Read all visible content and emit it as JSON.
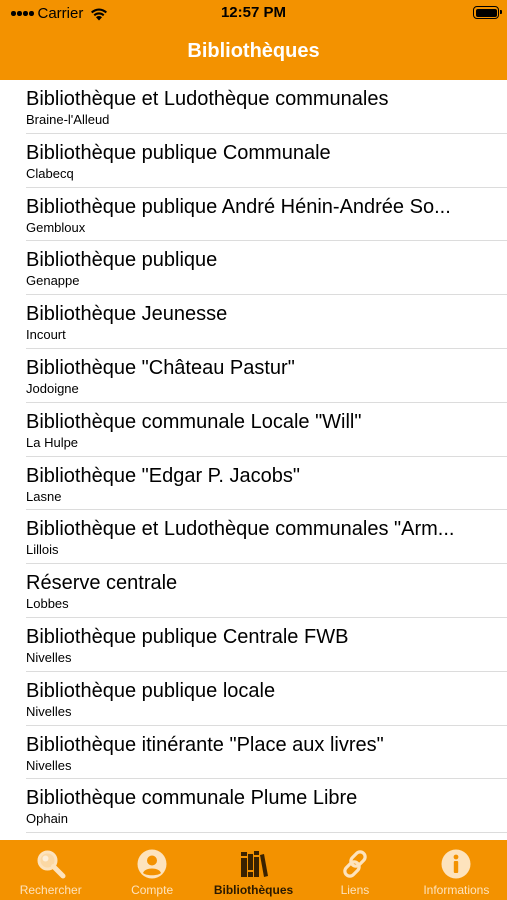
{
  "status_bar": {
    "carrier": "Carrier",
    "time": "12:57 PM"
  },
  "nav": {
    "title": "Bibliothèques"
  },
  "libraries": [
    {
      "name": "Bibliothèque et Ludothèque communales",
      "city": "Braine-l'Alleud"
    },
    {
      "name": "Bibliothèque publique Communale",
      "city": "Clabecq"
    },
    {
      "name": "Bibliothèque publique André Hénin-Andrée So...",
      "city": "Gembloux"
    },
    {
      "name": "Bibliothèque publique",
      "city": "Genappe"
    },
    {
      "name": "Bibliothèque Jeunesse",
      "city": "Incourt"
    },
    {
      "name": "Bibliothèque \"Château Pastur\"",
      "city": "Jodoigne"
    },
    {
      "name": "Bibliothèque communale Locale \"Will\"",
      "city": "La Hulpe"
    },
    {
      "name": "Bibliothèque \"Edgar P. Jacobs\"",
      "city": "Lasne"
    },
    {
      "name": "Bibliothèque et Ludothèque communales \"Arm...",
      "city": "Lillois"
    },
    {
      "name": "Réserve centrale",
      "city": "Lobbes"
    },
    {
      "name": "Bibliothèque publique Centrale FWB",
      "city": "Nivelles"
    },
    {
      "name": "Bibliothèque publique locale",
      "city": "Nivelles"
    },
    {
      "name": "Bibliothèque itinérante \"Place aux livres\"",
      "city": "Nivelles"
    },
    {
      "name": "Bibliothèque communale Plume Libre",
      "city": "Ophain"
    }
  ],
  "tabs": [
    {
      "label": "Rechercher",
      "icon": "search-icon"
    },
    {
      "label": "Compte",
      "icon": "user-icon"
    },
    {
      "label": "Bibliothèques",
      "icon": "books-icon",
      "active": true
    },
    {
      "label": "Liens",
      "icon": "link-icon"
    },
    {
      "label": "Informations",
      "icon": "info-icon"
    }
  ],
  "colors": {
    "accent": "#f39200",
    "tab_inactive_text": "#fde3bd",
    "tab_active_text": "#2b1a00"
  }
}
